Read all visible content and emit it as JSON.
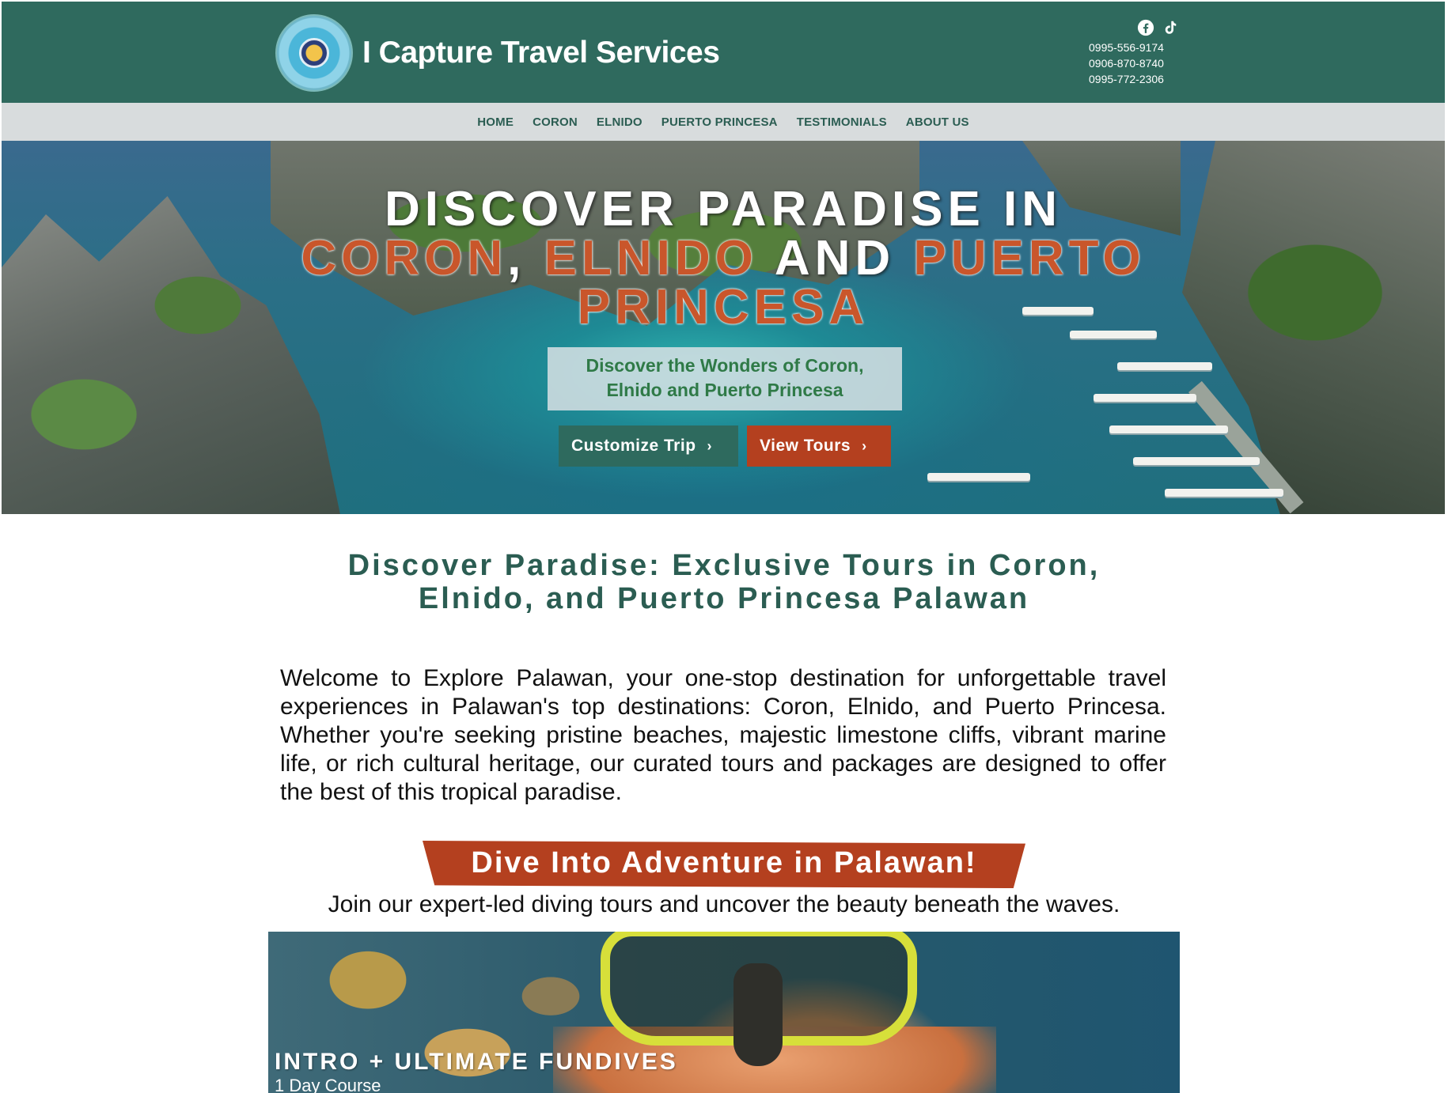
{
  "header": {
    "title": "I Capture Travel Services",
    "social_icons": [
      "facebook-icon",
      "tiktok-icon"
    ],
    "phones": [
      "0995-556-9174",
      "0906-870-8740",
      "0995-772-2306"
    ]
  },
  "nav": {
    "items": [
      "HOME",
      "CORON",
      "ELNIDO",
      "PUERTO PRINCESA",
      "TESTIMONIALS",
      "ABOUT US"
    ]
  },
  "hero": {
    "title_line1": "DISCOVER PARADISE IN",
    "title_coron": "CORON",
    "title_comma": ",",
    "title_elnido": "ELNIDO",
    "title_and": "AND",
    "title_puerto": "PUERTO",
    "title_princesa": "PRINCESA",
    "subtitle_line1": "Discover the Wonders of Coron,",
    "subtitle_line2": "Elnido and Puerto Princesa",
    "button_customize": "Customize Trip",
    "button_tours": "View Tours",
    "chevron": "›"
  },
  "intro": {
    "heading_line1": "Discover Paradise: Exclusive Tours in Coron,",
    "heading_line2": "Elnido, and Puerto Princesa Palawan",
    "body": "Welcome to Explore Palawan, your one-stop destination for unforgettable travel experiences in Palawan's top destinations: Coron, Elnido, and Puerto Princesa. Whether you're seeking pristine beaches, majestic limestone cliffs, vibrant marine life, or rich cultural heritage, our curated tours and packages are designed to offer the best of this tropical paradise."
  },
  "dive": {
    "banner": "Dive Into Adventure in Palawan!",
    "subtitle": "Join our expert-led diving tours and uncover the beauty beneath the waves.",
    "card_title": "INTRO + ULTIMATE FUNDIVES",
    "card_subtitle": "1 Day Course"
  },
  "colors": {
    "header_green": "#2f6a5e",
    "nav_gray": "#d8dcdd",
    "accent_orange": "#b4401f",
    "heading_green": "#2b5d52"
  }
}
